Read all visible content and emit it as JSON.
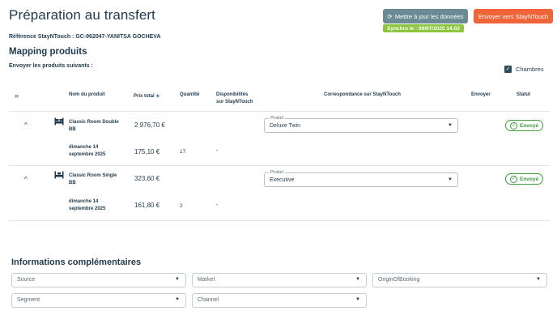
{
  "header": {
    "title": "Préparation au transfert",
    "update_button": "Mettre à jour les données",
    "send_button": "Envoyer vers StayNTouch",
    "sync_badge": "Synchro le : 08/07/2025 14:02",
    "reference": "Référence StayNTouch : GC-962047-YANITSA GOCHEVA"
  },
  "mapping": {
    "title": "Mapping produits",
    "subtitle": "Envoyer les produits suivants :",
    "filter": {
      "label": "Chambres",
      "checked": true
    }
  },
  "table": {
    "expand_all": "»",
    "headers": {
      "name": "Nom du produit",
      "price": "Prix total",
      "qty": "Quantité",
      "dispo_line1": "Disponibilités",
      "dispo_line2": "sur StayNTouch",
      "match": "Correspondance sur StayNTouch",
      "send": "Envoyer",
      "status": "Statut"
    },
    "rows": [
      {
        "name_line1": "Classic Room Double",
        "name_line2": "BB",
        "total": "2 976,70 €",
        "product_label": "Produit",
        "product_value": "Deluxe Twin",
        "status": "Envoyé",
        "sub": {
          "date_line1": "dimanche 14",
          "date_line2": "septembre 2025",
          "price": "175,10 €",
          "qty": "17",
          "dispo": "-"
        }
      },
      {
        "name_line1": "Classic Room Single",
        "name_line2": "BB",
        "total": "323,60 €",
        "product_label": "Produit",
        "product_value": "Executive",
        "status": "Envoyé",
        "sub": {
          "date_line1": "dimanche 14",
          "date_line2": "septembre 2025",
          "price": "161,80 €",
          "qty": "2",
          "dispo": "-"
        }
      }
    ]
  },
  "info": {
    "title": "Informations complémentaires",
    "fields": [
      "Source",
      "Market",
      "OriginOfBooking",
      "Segment",
      "Channel"
    ]
  },
  "colors": {
    "primary_text": "#1f3a4d",
    "update_button": "#6b8a94",
    "send_button": "#f0643a",
    "sync_badge": "#8cc63f",
    "status_green": "#3f9a3f"
  }
}
